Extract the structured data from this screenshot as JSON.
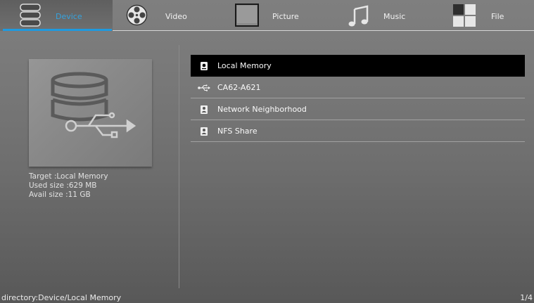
{
  "tabs": [
    {
      "label": "Device",
      "icon": "database-icon",
      "active": true
    },
    {
      "label": "Video",
      "icon": "film-reel-icon",
      "active": false
    },
    {
      "label": "Picture",
      "icon": "picture-frame-icon",
      "active": false
    },
    {
      "label": "Music",
      "icon": "music-note-icon",
      "active": false
    },
    {
      "label": "File",
      "icon": "file-grid-icon",
      "active": false
    }
  ],
  "accent_color": "#1e9ae0",
  "device_info": {
    "thumbnail_icon": "database-usb-icon",
    "target": "Target :Local Memory",
    "used": "Used size :629 MB",
    "avail": "Avail size :11 GB"
  },
  "devices": [
    {
      "label": "Local Memory",
      "icon": "local-storage-icon",
      "selected": true
    },
    {
      "label": "CA62-A621",
      "icon": "usb-icon",
      "selected": false
    },
    {
      "label": "Network Neighborhood",
      "icon": "network-share-icon",
      "selected": false
    },
    {
      "label": "NFS Share",
      "icon": "nfs-share-icon",
      "selected": false
    }
  ],
  "status": {
    "directory": "directory:Device/Local Memory",
    "page": "1/4"
  }
}
